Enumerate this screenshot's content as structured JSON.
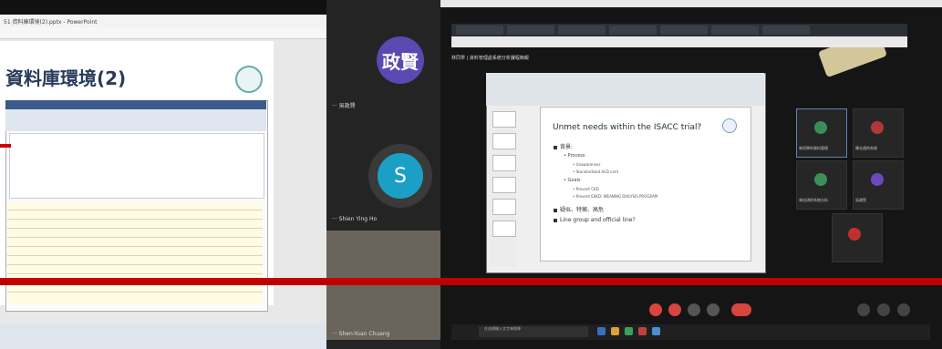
{
  "left_share": {
    "window_title": "51 資料庫環境(2).pptx - PowerPoint",
    "slide_title": "資料庫環境(2)"
  },
  "middle_participants": {
    "avatar1_text": "政賢",
    "label1": "吳政賢",
    "avatar2_text": "S",
    "label2": "Shien Ying Ho",
    "label3": "Shen-Yuan Chuang"
  },
  "right_share": {
    "meeting_header": "林同學 | 資料管理處系統分析課程簡報",
    "slide": {
      "title": "Unmet needs within the ISACC trial?",
      "bullets": [
        {
          "level": 1,
          "text": "背景:"
        },
        {
          "level": 2,
          "text": "Process"
        },
        {
          "level": 3,
          "text": "Unawareness"
        },
        {
          "level": 3,
          "text": "Standardized ACD card"
        },
        {
          "level": 2,
          "text": "Goals"
        },
        {
          "level": 3,
          "text": "Prevent CKD"
        },
        {
          "level": 3,
          "text": "Prevent ESKD: WEANING DIALYSIS PROGRAM"
        },
        {
          "level": 1,
          "text": "疑似、特徵、高危"
        },
        {
          "level": 1,
          "text": "Line group and official line?"
        }
      ]
    },
    "participants": [
      {
        "name": "林同學的資料管理"
      },
      {
        "name": "陳志遠的系統"
      },
      {
        "name": "林佳琪的系統分析"
      },
      {
        "name": "吳政賢"
      }
    ],
    "taskbar_search": "在這裡輸入文字來搜尋"
  },
  "colors": {
    "red_bar": "#c00000",
    "avatar_purple": "#5b48b0",
    "avatar_blue": "#1c9fc4"
  }
}
